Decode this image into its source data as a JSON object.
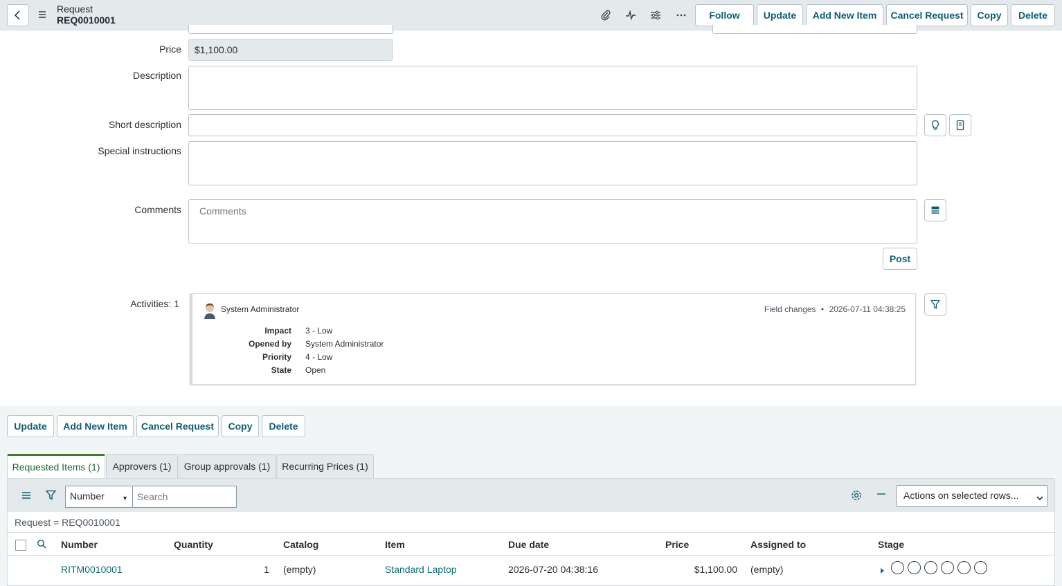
{
  "header": {
    "record_type": "Request",
    "record_number": "REQ0010001",
    "buttons": {
      "follow": "Follow",
      "update": "Update",
      "add_new_item": "Add New Item",
      "cancel_request": "Cancel Request",
      "copy": "Copy",
      "delete": "Delete"
    },
    "icons": [
      "back-icon",
      "menu-icon",
      "paperclip-icon",
      "activity-icon",
      "sliders-icon",
      "more-icon"
    ]
  },
  "form": {
    "price_label": "Price",
    "price_value": "$1,100.00",
    "description_label": "Description",
    "description_value": "",
    "short_description_label": "Short description",
    "short_description_value": "",
    "special_instructions_label": "Special instructions",
    "special_instructions_value": "",
    "comments_label": "Comments",
    "comments_placeholder": "Comments",
    "post_label": "Post"
  },
  "activities": {
    "label": "Activities: 1",
    "entry": {
      "user": "System Administrator",
      "type": "Field changes",
      "separator": "•",
      "timestamp": "2026-07-11 04:38:25",
      "fields": [
        {
          "name": "Impact",
          "value": "3 - Low"
        },
        {
          "name": "Opened by",
          "value": "System Administrator"
        },
        {
          "name": "Priority",
          "value": "4 - Low"
        },
        {
          "name": "State",
          "value": "Open"
        }
      ]
    }
  },
  "bottom_buttons": {
    "update": "Update",
    "add_new_item": "Add New Item",
    "cancel_request": "Cancel Request",
    "copy": "Copy",
    "delete": "Delete"
  },
  "tabs": [
    {
      "label": "Requested Items (1)",
      "active": true
    },
    {
      "label": "Approvers (1)",
      "active": false
    },
    {
      "label": "Group approvals (1)",
      "active": false
    },
    {
      "label": "Recurring Prices (1)",
      "active": false
    }
  ],
  "list": {
    "search_field": "Number",
    "search_placeholder": "Search",
    "actions_select": "Actions on selected rows...",
    "breadcrumb": "Request = REQ0010001",
    "columns": [
      "Number",
      "Quantity",
      "Catalog",
      "Item",
      "Due date",
      "Price",
      "Assigned to",
      "Stage"
    ],
    "rows": [
      {
        "number": "RITM0010001",
        "quantity": "1",
        "catalog": "(empty)",
        "item": "Standard Laptop",
        "due_date": "2026-07-20 04:38:16",
        "price": "$1,100.00",
        "assigned_to": "(empty)",
        "stage_steps": 6
      }
    ]
  },
  "colors": {
    "header_bg": "#e4e9ec",
    "button_text": "#0e5d73",
    "link": "#0e6d76",
    "active_tab_border": "#3f7a2f"
  }
}
